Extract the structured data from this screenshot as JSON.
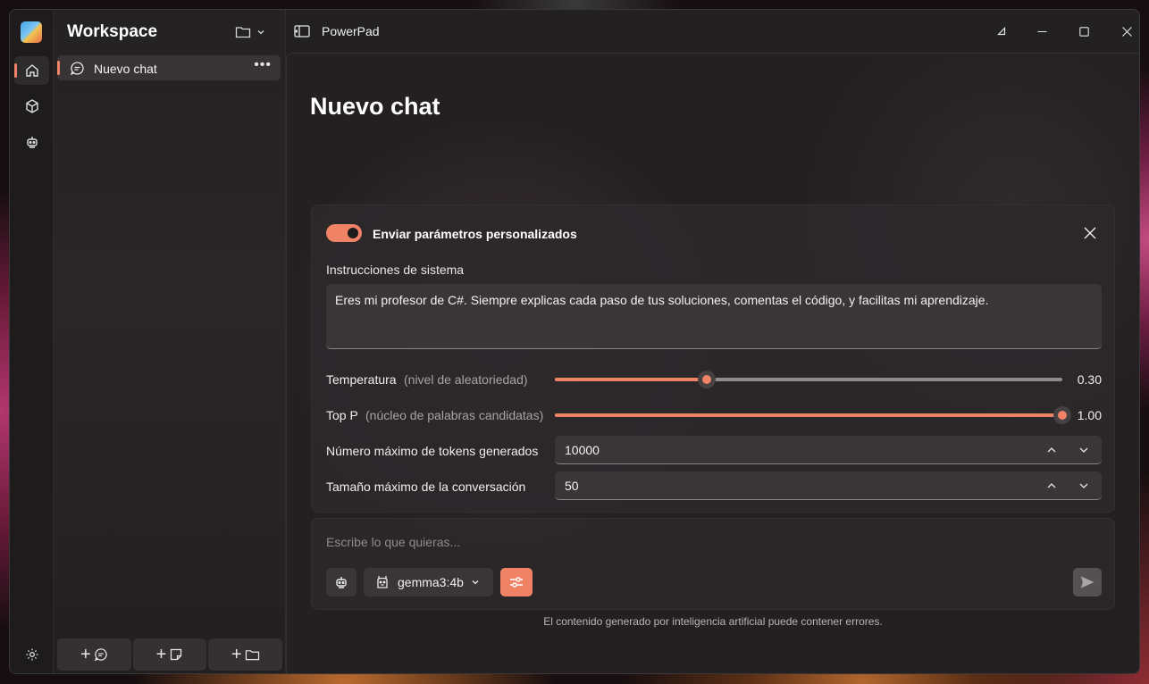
{
  "app": {
    "name": "PowerPad"
  },
  "sidebar": {
    "title": "Workspace",
    "chats": [
      {
        "label": "Nuevo chat",
        "more": "•••"
      }
    ],
    "footer_plus": "+"
  },
  "main": {
    "title": "Nuevo chat"
  },
  "params": {
    "toggle_label": "Enviar parámetros personalizados",
    "toggle_on": true,
    "system_label": "Instrucciones de sistema",
    "system_value": "Eres mi profesor de C#. Siempre explicas cada paso de tus soluciones, comentas el código, y facilitas mi aprendizaje.",
    "temperature": {
      "label": "Temperatura",
      "hint": "(nivel de aleatoriedad)",
      "value": 0.3,
      "value_text": "0.30"
    },
    "top_p": {
      "label": "Top P",
      "hint": "(núcleo de palabras candidatas)",
      "value": 1.0,
      "value_text": "1.00"
    },
    "max_tokens": {
      "label": "Número máximo de tokens generados",
      "value": "10000"
    },
    "max_conversation": {
      "label": "Tamaño máximo de la conversación",
      "value": "50"
    }
  },
  "composer": {
    "placeholder": "Escribe lo que quieras...",
    "model": "gemma3:4b"
  },
  "disclaimer": "El contenido generado por inteligencia artificial puede contener errores.",
  "colors": {
    "accent": "#f08266",
    "background": "#242022",
    "panel": "#2c282a"
  }
}
